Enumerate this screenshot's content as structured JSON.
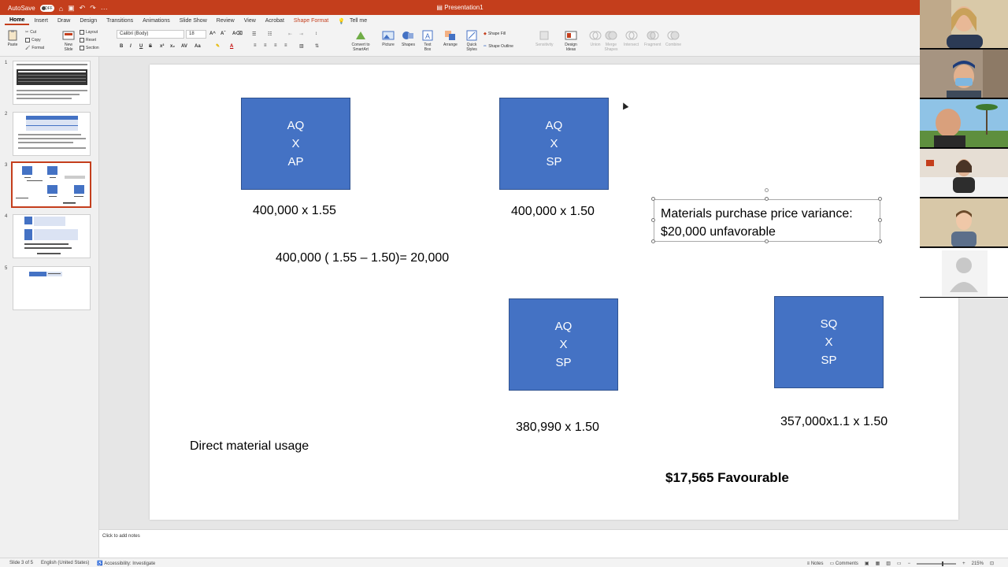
{
  "titlebar": {
    "autosave_label": "AutoSave",
    "autosave_state": "OFF",
    "doc_title": "Presentation1",
    "more": "···"
  },
  "tabs": [
    {
      "label": "Home",
      "active": true
    },
    {
      "label": "Insert"
    },
    {
      "label": "Draw"
    },
    {
      "label": "Design"
    },
    {
      "label": "Transitions"
    },
    {
      "label": "Animations"
    },
    {
      "label": "Slide Show"
    },
    {
      "label": "Review"
    },
    {
      "label": "View"
    },
    {
      "label": "Acrobat"
    },
    {
      "label": "Shape Format",
      "contextual": true
    },
    {
      "label": "Tell me"
    }
  ],
  "ribbon": {
    "paste": "Paste",
    "cut": "Cut",
    "copy": "Copy",
    "format": "Format",
    "new_slide": "New Slide",
    "layout": "Layout",
    "reset": "Reset",
    "section": "Section",
    "font_name": "Calibri (Body)",
    "font_size": "18",
    "convert_smartart": "Convert to SmartArt",
    "picture": "Picture",
    "shapes": "Shapes",
    "text_box": "Text Box",
    "arrange": "Arrange",
    "quick_styles": "Quick Styles",
    "shape_fill": "Shape Fill",
    "shape_outline": "Shape Outline",
    "sensitivity": "Sensitivity",
    "design_ideas": "Design Ideas",
    "union": "Union",
    "merge_shapes": "Merge Shapes",
    "intersect": "Intersect",
    "fragment": "Fragment",
    "combine": "Combine"
  },
  "thumbnails": [
    {
      "num": "1"
    },
    {
      "num": "2"
    },
    {
      "num": "3",
      "selected": true
    },
    {
      "num": "4"
    },
    {
      "num": "5"
    }
  ],
  "slide": {
    "box1": {
      "l1": "AQ",
      "l2": "X",
      "l3": "AP"
    },
    "box2": {
      "l1": "AQ",
      "l2": "X",
      "l3": "SP"
    },
    "box3": {
      "l1": "AQ",
      "l2": "X",
      "l3": "SP"
    },
    "box4": {
      "l1": "SQ",
      "l2": "X",
      "l3": "SP"
    },
    "calc1": "400,000 x 1.55",
    "calc2": "400,000 x 1.50",
    "formula": "400,000 ( 1.55 – 1.50)= 20,000",
    "price_variance_l1": "Materials purchase price variance:",
    "price_variance_l2": "$20,000 unfavorable",
    "calc3": "380,990 x 1.50",
    "calc4": "357,000x1.1 x 1.50",
    "usage_label": "Direct material usage",
    "usage_result": "$17,565 Favourable"
  },
  "notes": {
    "placeholder": "Click to add notes"
  },
  "status": {
    "slide_of": "Slide 3 of 5",
    "language": "English (United States)",
    "accessibility": "Accessibility: Investigate",
    "notes_btn": "Notes",
    "comments_btn": "Comments",
    "zoom": "215%"
  },
  "colors": {
    "accent": "#c43e1c",
    "box_fill": "#4472c4"
  }
}
